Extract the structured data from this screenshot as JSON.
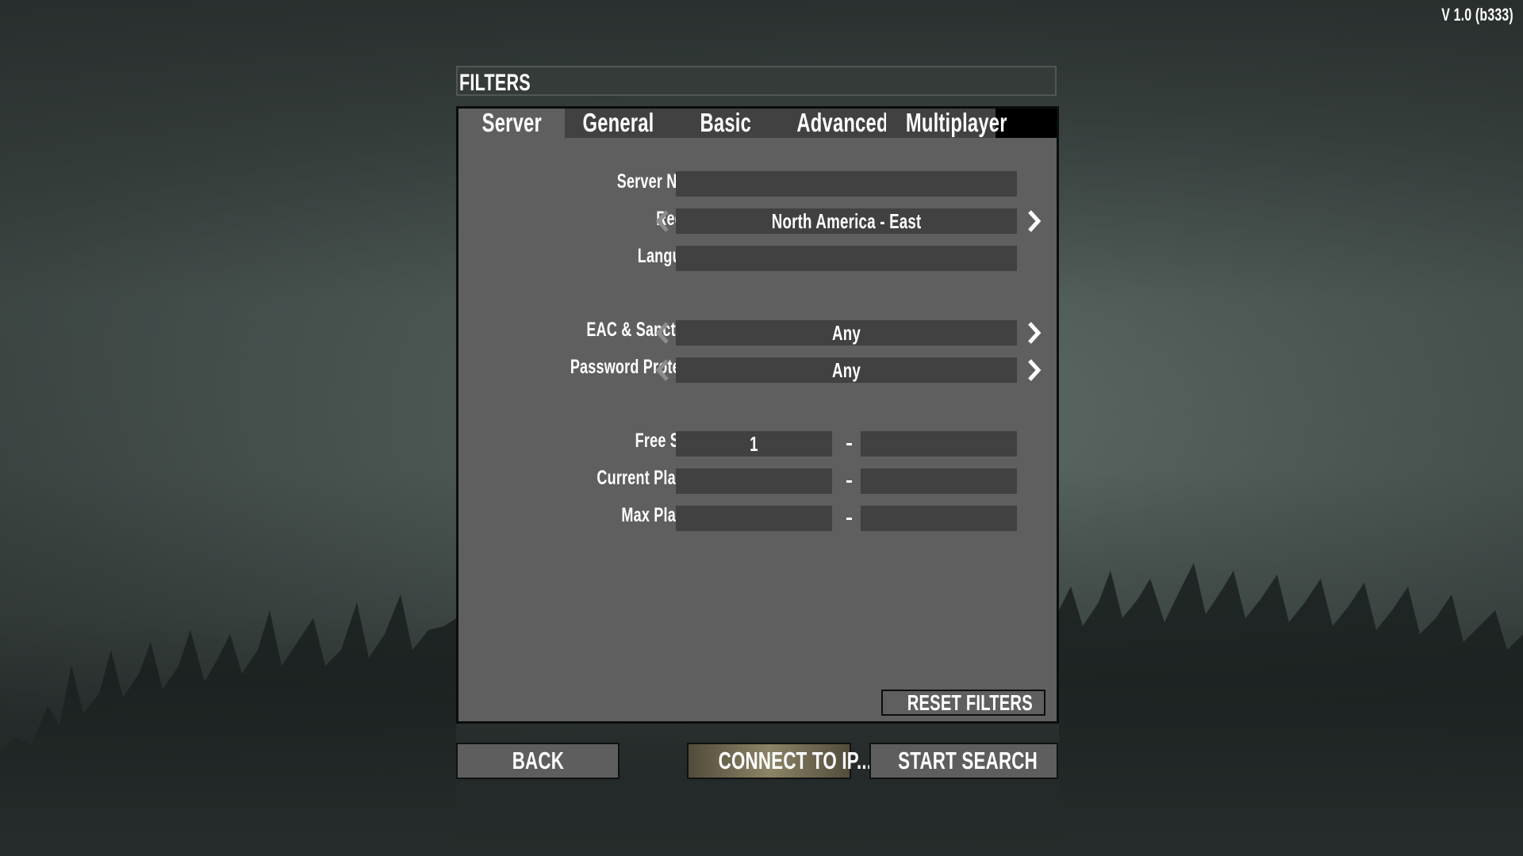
{
  "app": {
    "version": "V 1.0 (b333)"
  },
  "dialog": {
    "title": "FILTERS",
    "tabs": [
      {
        "label": "Server",
        "active": true
      },
      {
        "label": "General",
        "active": false
      },
      {
        "label": "Basic",
        "active": false
      },
      {
        "label": "Advanced",
        "active": false
      },
      {
        "label": "Multiplayer",
        "active": false
      }
    ],
    "fields": {
      "server_name": {
        "label": "Server Name",
        "value": ""
      },
      "region": {
        "label": "Region",
        "value": "North America - East",
        "prev_icon": "chevron-left-icon",
        "next_icon": "chevron-right-icon"
      },
      "language": {
        "label": "Language",
        "value": ""
      },
      "eac": {
        "label": "EAC & Sanctions",
        "value": "Any"
      },
      "password": {
        "label": "Password Protected",
        "value": "Any"
      },
      "free_slots": {
        "label": "Free Slots",
        "min": "1",
        "max": "",
        "separator": "-"
      },
      "current_players": {
        "label": "Current Players",
        "min": "",
        "max": "",
        "separator": "-"
      },
      "max_players": {
        "label": "Max Players",
        "min": "",
        "max": "",
        "separator": "-"
      }
    },
    "reset_label": "RESET FILTERS"
  },
  "footer": {
    "back_label": "BACK",
    "connect_label": "CONNECT TO IP...",
    "search_label": "START SEARCH"
  },
  "colors": {
    "panel_bg": "#5f5f5f",
    "field_bg": "#414141",
    "highlight_button": "#8c8466"
  }
}
